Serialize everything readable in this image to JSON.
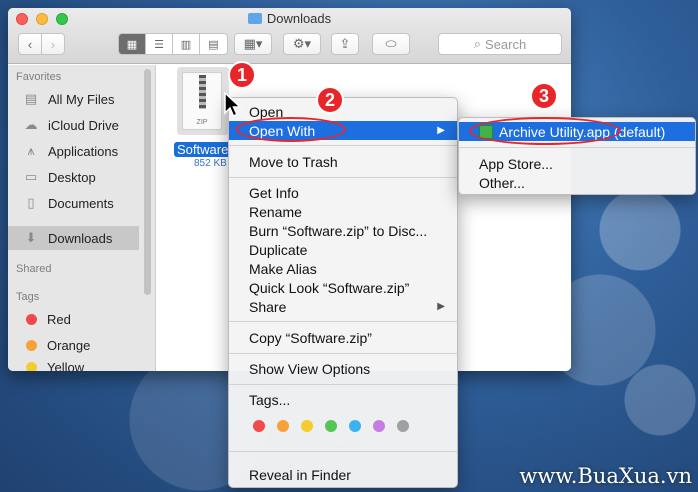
{
  "window": {
    "title": "Downloads",
    "search_placeholder": "Search"
  },
  "sidebar": {
    "favorites_heading": "Favorites",
    "favorites": [
      {
        "label": "All My Files",
        "icon": "files-icon"
      },
      {
        "label": "iCloud Drive",
        "icon": "cloud-icon"
      },
      {
        "label": "Applications",
        "icon": "applications-icon"
      },
      {
        "label": "Desktop",
        "icon": "desktop-icon"
      },
      {
        "label": "Documents",
        "icon": "documents-icon"
      },
      {
        "label": "Downloads",
        "icon": "downloads-icon",
        "selected": true
      }
    ],
    "shared_heading": "Shared",
    "tags_heading": "Tags",
    "tags": [
      {
        "label": "Red",
        "color": "#f24a4a"
      },
      {
        "label": "Orange",
        "color": "#f6a13a"
      },
      {
        "label": "Yellow",
        "color": "#f5cc2e"
      }
    ]
  },
  "file": {
    "thumb_label": "ZIP",
    "name": "Software",
    "size": "852 KB"
  },
  "context_menu": {
    "open": "Open",
    "open_with": "Open With",
    "move_to_trash": "Move to Trash",
    "get_info": "Get Info",
    "rename": "Rename",
    "burn": "Burn “Software.zip” to Disc...",
    "duplicate": "Duplicate",
    "make_alias": "Make Alias",
    "quick_look": "Quick Look “Software.zip”",
    "share": "Share",
    "copy": "Copy “Software.zip”",
    "show_view_options": "Show View Options",
    "tags": "Tags...",
    "tag_colors": [
      "#f24a4a",
      "#f6a13a",
      "#f5cc2e",
      "#55c553",
      "#3ab4f0",
      "#c77de0",
      "#a0a0a0"
    ],
    "reveal_in_finder": "Reveal in Finder"
  },
  "submenu": {
    "default_app": "Archive Utility.app (default)",
    "app_store": "App Store...",
    "other": "Other..."
  },
  "annotations": {
    "step1": "1",
    "step2": "2",
    "step3": "3",
    "accent": "#e8262a"
  },
  "watermark": "www.BuaXua.vn"
}
